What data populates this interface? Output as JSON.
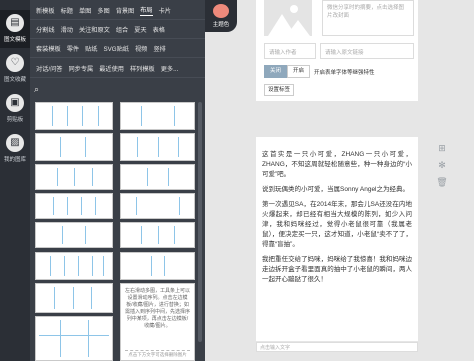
{
  "rail": {
    "items": [
      {
        "label": "图文模板",
        "icon": "layout-icon",
        "glyph": "▤"
      },
      {
        "label": "图文收藏",
        "icon": "collection-icon",
        "glyph": "♡"
      },
      {
        "label": "剪贴板",
        "icon": "clipboard-icon",
        "glyph": "▣"
      },
      {
        "label": "我的图库",
        "icon": "gallery-icon",
        "glyph": "▨"
      }
    ]
  },
  "menu": {
    "row1": [
      "新模板",
      "标题",
      "单图",
      "多图",
      "背景图",
      "布局",
      "卡片"
    ],
    "row2": [
      "分割线",
      "滑动",
      "关注和原文",
      "组合",
      "夏天",
      "表格"
    ],
    "row3": [
      "套装模板",
      "零件",
      "贴纸",
      "SVG贴纸",
      "视频",
      "竖排"
    ],
    "row4": [
      "对话/问答",
      "同步专属",
      "最近使用",
      "样列模板",
      "更多..."
    ],
    "active": "布局"
  },
  "search": {
    "icon": "search-icon",
    "glyph": "⌕"
  },
  "thumbs": {
    "text_tip": "左右滑动多图，工具条上可以设置滑动序列。点击左边模板/收藏/图片，进行替换；如需插入到序列中间，先选择序列中某项，再点击左边模板/收藏/图片。",
    "foot_tip": "点击下方文字可选择删除图片"
  },
  "theme": {
    "label": "主题色",
    "color": "#ee8a7c"
  },
  "settings": {
    "summary_placeholder": "微信分享时的摘要，点击选择图片改封面",
    "author_placeholder": "请输入作者",
    "link_placeholder": "请输入原文链接",
    "toggle_off": "关闭",
    "toggle_on": "开启",
    "toggle_note": "开启表单字体等继强特性",
    "tag_button": "设置标签"
  },
  "article": {
    "paragraphs": [
      "这首实是一只小可爱，ZHANG一只小可爱，ZHANG，不知这周就轻松随意些，种一种身边的“小可爱”吧。",
      "说到玩偶类的小可爱，当属Sonny Angel之为经典。",
      "第一次遇见SA，在2014年末，那会儿SA还没在内地火爆起来，却已经有相当大规模的陈列，如少入问津，我和妈咪经过，觉得小老鼠很可靠（我属老鼠），便决定买一只，这才知道，小老鼠“卖不了了，得靠“盲抽”。",
      "我把重任交给了妈咪，妈咪给了我惊喜！我和妈咪边走边拆开盒子看里面真的抽中了小老鼠的瞬间，两人一起开心蹦跶了很久！"
    ],
    "caption_placeholder": "点击输入文字"
  },
  "tools": [
    {
      "icon": "grid-icon",
      "glyph": "⊞"
    },
    {
      "icon": "settings-icon",
      "glyph": "✻"
    },
    {
      "icon": "delete-icon",
      "glyph": "🗑"
    }
  ],
  "colors": {
    "rail": "#2b2f36",
    "panel": "#3a3f47",
    "accent": "#8fa8bc",
    "guide": "#8ec5e8"
  }
}
